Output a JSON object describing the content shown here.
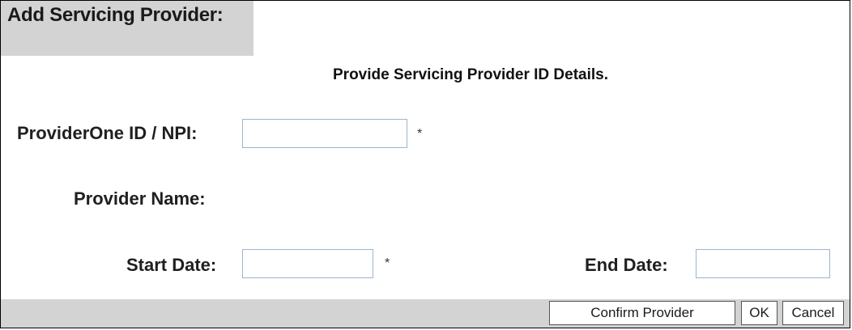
{
  "dialog": {
    "title": "Add Servicing Provider:",
    "subtitle": "Provide Servicing Provider ID Details."
  },
  "form": {
    "provider_id_label": "ProviderOne ID / NPI:",
    "provider_id_value": "",
    "provider_id_required": "*",
    "provider_name_label": "Provider Name:",
    "start_date_label": "Start Date:",
    "start_date_value": "",
    "start_date_required": "*",
    "end_date_label": "End Date:",
    "end_date_value": ""
  },
  "buttons": {
    "confirm_label": "Confirm Provider",
    "ok_label": "OK",
    "cancel_label": "Cancel"
  },
  "colors": {
    "panel_gray": "#d3d3d3",
    "field_border": "#9ab4cf"
  }
}
